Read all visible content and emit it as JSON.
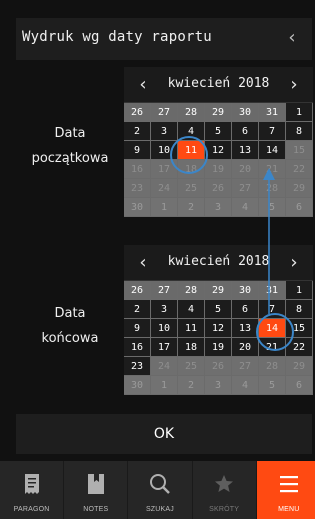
{
  "header": {
    "title": "Wydruk wg daty raportu",
    "back_icon": "‹"
  },
  "start": {
    "label_line1": "Data",
    "label_line2": "początkowa",
    "month": "kwiecień 2018",
    "prev": "‹",
    "next": "›",
    "days": [
      {
        "t": "26",
        "k": "prev"
      },
      {
        "t": "27",
        "k": "prev"
      },
      {
        "t": "28",
        "k": "prev"
      },
      {
        "t": "29",
        "k": "prev"
      },
      {
        "t": "30",
        "k": "prev"
      },
      {
        "t": "31",
        "k": "prev"
      },
      {
        "t": "1",
        "k": "cur"
      },
      {
        "t": "2",
        "k": "cur"
      },
      {
        "t": "3",
        "k": "cur"
      },
      {
        "t": "4",
        "k": "cur"
      },
      {
        "t": "5",
        "k": "cur"
      },
      {
        "t": "6",
        "k": "cur"
      },
      {
        "t": "7",
        "k": "cur"
      },
      {
        "t": "8",
        "k": "cur"
      },
      {
        "t": "9",
        "k": "cur"
      },
      {
        "t": "10",
        "k": "cur"
      },
      {
        "t": "11",
        "k": "sel"
      },
      {
        "t": "12",
        "k": "cur"
      },
      {
        "t": "13",
        "k": "cur"
      },
      {
        "t": "14",
        "k": "cur"
      },
      {
        "t": "15",
        "k": "dis"
      },
      {
        "t": "16",
        "k": "dis"
      },
      {
        "t": "17",
        "k": "dis"
      },
      {
        "t": "18",
        "k": "dis"
      },
      {
        "t": "19",
        "k": "dis"
      },
      {
        "t": "20",
        "k": "dis"
      },
      {
        "t": "21",
        "k": "dis"
      },
      {
        "t": "22",
        "k": "dis"
      },
      {
        "t": "23",
        "k": "dis"
      },
      {
        "t": "24",
        "k": "dis"
      },
      {
        "t": "25",
        "k": "dis"
      },
      {
        "t": "26",
        "k": "dis"
      },
      {
        "t": "27",
        "k": "dis"
      },
      {
        "t": "28",
        "k": "dis"
      },
      {
        "t": "29",
        "k": "dis"
      },
      {
        "t": "30",
        "k": "next"
      },
      {
        "t": "1",
        "k": "next"
      },
      {
        "t": "2",
        "k": "next"
      },
      {
        "t": "3",
        "k": "next"
      },
      {
        "t": "4",
        "k": "next"
      },
      {
        "t": "5",
        "k": "next"
      },
      {
        "t": "6",
        "k": "next"
      }
    ]
  },
  "end": {
    "label_line1": "Data",
    "label_line2": "końcowa",
    "month": "kwiecień 2018",
    "prev": "‹",
    "next": "›",
    "days": [
      {
        "t": "26",
        "k": "prev"
      },
      {
        "t": "27",
        "k": "prev"
      },
      {
        "t": "28",
        "k": "prev"
      },
      {
        "t": "29",
        "k": "prev"
      },
      {
        "t": "30",
        "k": "prev"
      },
      {
        "t": "31",
        "k": "prev"
      },
      {
        "t": "1",
        "k": "cur"
      },
      {
        "t": "2",
        "k": "cur"
      },
      {
        "t": "3",
        "k": "cur"
      },
      {
        "t": "4",
        "k": "cur"
      },
      {
        "t": "5",
        "k": "cur"
      },
      {
        "t": "6",
        "k": "cur"
      },
      {
        "t": "7",
        "k": "cur"
      },
      {
        "t": "8",
        "k": "cur"
      },
      {
        "t": "9",
        "k": "cur"
      },
      {
        "t": "10",
        "k": "cur"
      },
      {
        "t": "11",
        "k": "cur"
      },
      {
        "t": "12",
        "k": "cur"
      },
      {
        "t": "13",
        "k": "cur"
      },
      {
        "t": "14",
        "k": "sel"
      },
      {
        "t": "15",
        "k": "cur"
      },
      {
        "t": "16",
        "k": "cur"
      },
      {
        "t": "17",
        "k": "cur"
      },
      {
        "t": "18",
        "k": "cur"
      },
      {
        "t": "19",
        "k": "cur"
      },
      {
        "t": "20",
        "k": "cur"
      },
      {
        "t": "21",
        "k": "cur"
      },
      {
        "t": "22",
        "k": "cur"
      },
      {
        "t": "23",
        "k": "cur"
      },
      {
        "t": "24",
        "k": "dis"
      },
      {
        "t": "25",
        "k": "dis"
      },
      {
        "t": "26",
        "k": "dis"
      },
      {
        "t": "27",
        "k": "dis"
      },
      {
        "t": "28",
        "k": "dis"
      },
      {
        "t": "29",
        "k": "dis"
      },
      {
        "t": "30",
        "k": "next"
      },
      {
        "t": "1",
        "k": "next"
      },
      {
        "t": "2",
        "k": "next"
      },
      {
        "t": "3",
        "k": "next"
      },
      {
        "t": "4",
        "k": "next"
      },
      {
        "t": "5",
        "k": "next"
      },
      {
        "t": "6",
        "k": "next"
      }
    ]
  },
  "ok_label": "OK",
  "tabs": [
    {
      "label": "PARAGON",
      "icon": "receipt-icon"
    },
    {
      "label": "NOTES",
      "icon": "notes-icon"
    },
    {
      "label": "SZUKAJ",
      "icon": "search-icon"
    },
    {
      "label": "SKRÓTY",
      "icon": "star-icon"
    },
    {
      "label": "MENU",
      "icon": "menu-icon"
    }
  ],
  "colors": {
    "accent": "#ff4a12",
    "annotation": "#3b86c9",
    "bg": "#111111"
  }
}
